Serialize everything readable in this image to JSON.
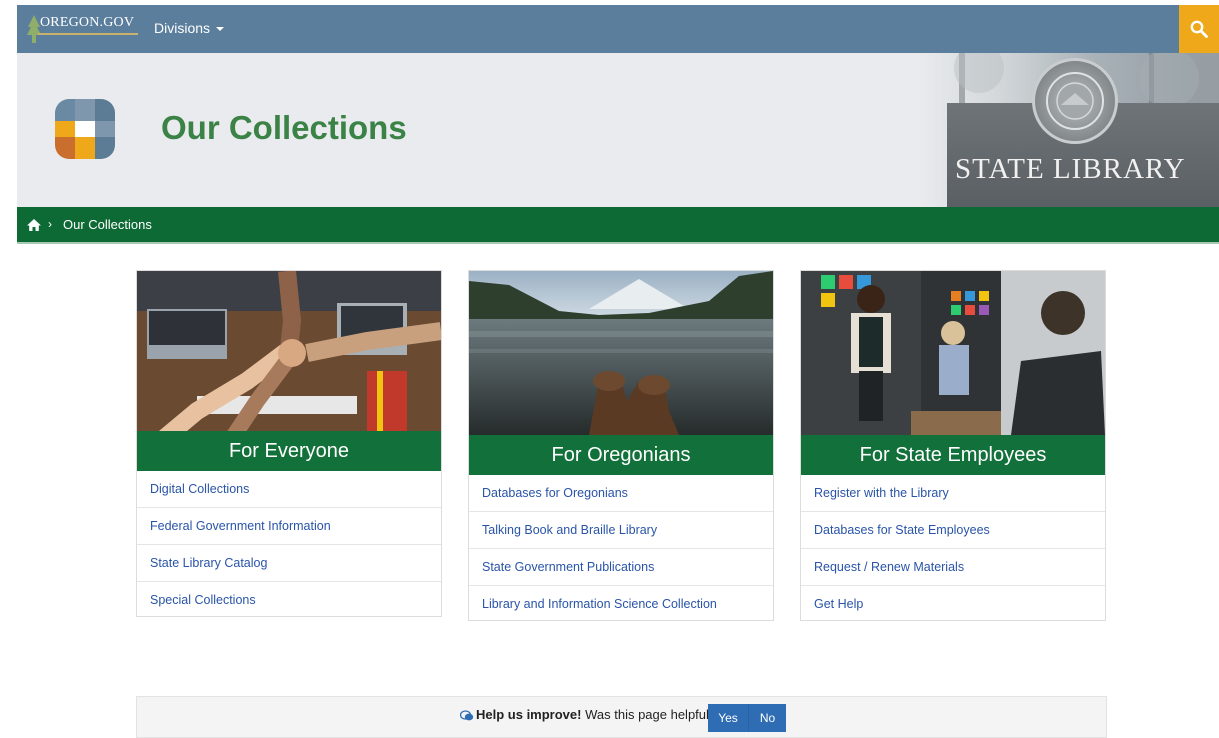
{
  "header": {
    "logo_text": "OREGON.GOV",
    "divisions_label": "Divisions"
  },
  "banner": {
    "title": "Our Collections",
    "sign_text": "STATE LIBRARY"
  },
  "breadcrumb": {
    "separator": "›",
    "current": "Our Collections"
  },
  "cards": [
    {
      "title": "For Everyone",
      "links": [
        "Digital Collections",
        "Federal Government Information",
        "State Library Catalog",
        "Special Collections"
      ]
    },
    {
      "title": "For Oregonians",
      "links": [
        "Databases for Oregonians",
        "Talking Book and Braille Library",
        "State Government Publications",
        "Library and Information Science Collection"
      ]
    },
    {
      "title": "For State Employees",
      "links": [
        "Register with the Library",
        "Databases for State Employees",
        "Request / Renew Materials",
        "Get Help"
      ]
    }
  ],
  "feedback": {
    "bold": "Help us improve!",
    "question": "Was this page helpful?",
    "yes": "Yes",
    "no": "No"
  },
  "colors": {
    "topbar": "#5a7e9c",
    "search_accent": "#f0a81b",
    "title_green": "#3b8246",
    "band_green": "#12703a",
    "link_blue": "#2954a8",
    "button_blue": "#2e6db4"
  }
}
